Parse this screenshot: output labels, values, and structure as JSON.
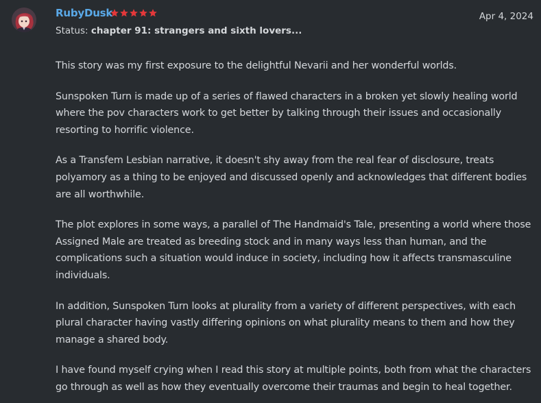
{
  "review": {
    "username": "RubyDusk",
    "rating": 5,
    "star_color": "#e3383a",
    "date": "Apr 4, 2024",
    "status_label": "Status:",
    "status_value": "chapter 91: strangers and sixth lovers...",
    "avatar_icon": "user-avatar-icon",
    "paragraphs": [
      "This story was my first exposure to the delightful Nevarii and her wonderful worlds.",
      "Sunspoken Turn is made up of a series of flawed characters in a broken yet slowly healing world where the pov characters work to get better by talking through their issues and occasionally resorting to horrific violence.",
      "As a Transfem Lesbian narrative, it doesn't shy away from the real fear of disclosure, treats polyamory as a thing to be enjoyed and discussed openly and acknowledges that different bodies are all worthwhile.",
      "The plot explores in some ways, a parallel of The Handmaid's Tale, presenting a world where those Assigned Male are treated as breeding stock and in many ways less than human, and the complications such a situation would induce in society, including how it affects transmasculine individuals.",
      "In addition, Sunspoken Turn looks at plurality from a variety of different perspectives, with each plural character having vastly differing opinions on what plurality means to them and how they manage a shared body.",
      "I have found myself crying when I read this story at multiple points, both from what the characters go through as well as how they eventually overcome their traumas and begin to heal together."
    ]
  },
  "colors": {
    "background": "#282c30",
    "username": "#5aa9e8",
    "text": "#d5d8dc"
  }
}
